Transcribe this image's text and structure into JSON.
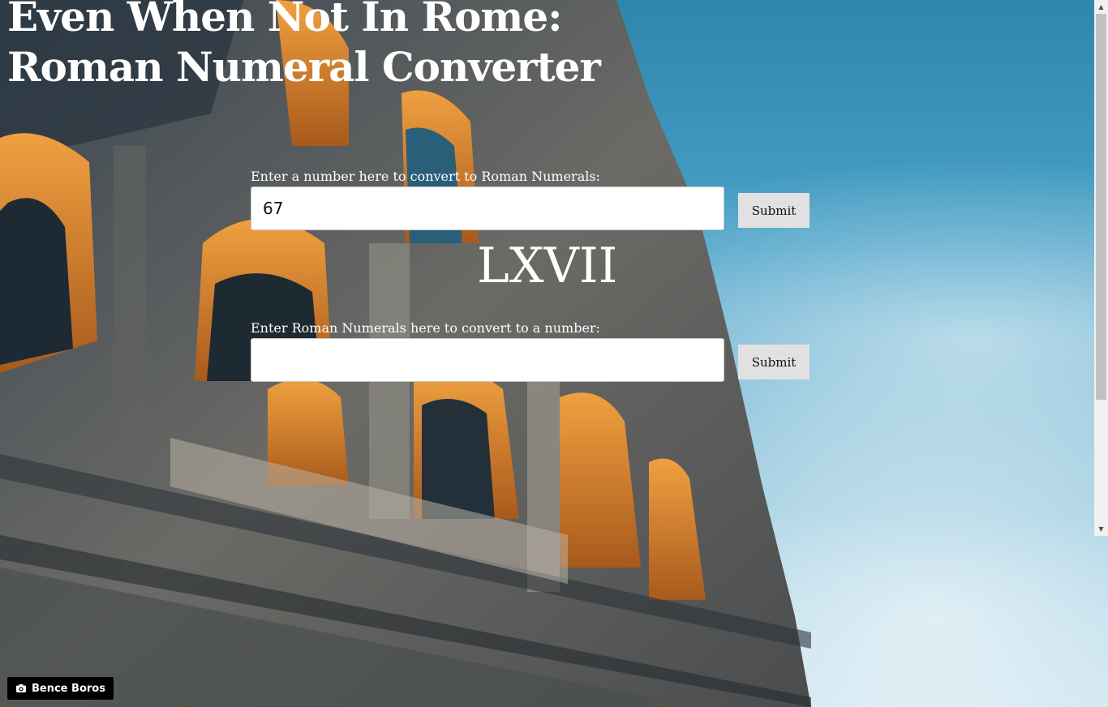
{
  "page": {
    "title": "Even When Not In Rome: Roman Numeral Converter",
    "title_line1": "Even When Not In Rome:",
    "title_line2": "Roman Numeral Converter"
  },
  "number_to_roman": {
    "label": "Enter a number here to convert to Roman Numerals:",
    "value": "67",
    "submit_label": "Submit"
  },
  "result": {
    "text": "LXVII"
  },
  "roman_to_number": {
    "label": "Enter Roman Numerals here to convert to a number:",
    "value": "",
    "submit_label": "Submit"
  },
  "photo_credit": {
    "icon": "camera-icon",
    "name": "Bence Boros"
  },
  "colors": {
    "input_bg": "#ffffff",
    "button_bg": "#e1e1e1",
    "text": "#ffffff",
    "credit_bg": "#000000"
  }
}
